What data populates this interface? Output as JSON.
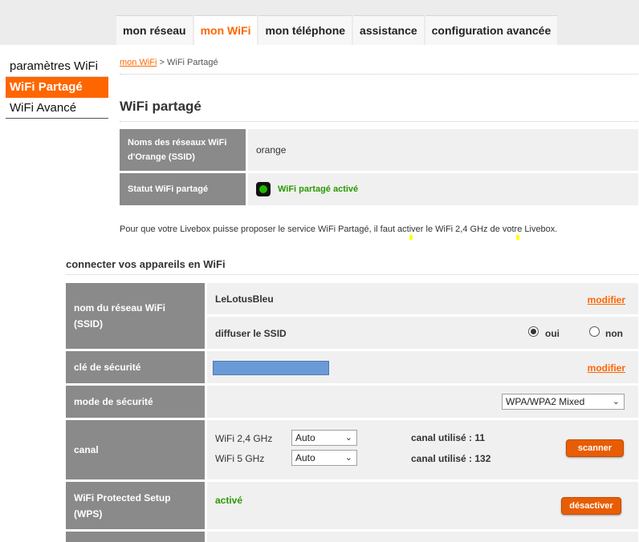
{
  "tabs": [
    {
      "label": "mon réseau"
    },
    {
      "label": "mon WiFi"
    },
    {
      "label": "mon téléphone"
    },
    {
      "label": "assistance"
    },
    {
      "label": "configuration avancée"
    }
  ],
  "active_tab": "mon WiFi",
  "sidebar": {
    "items": [
      {
        "label": "paramètres WiFi"
      },
      {
        "label": "WiFi Partagé"
      },
      {
        "label": "WiFi Avancé"
      }
    ],
    "active": "WiFi Partagé"
  },
  "breadcrumb": {
    "parent": "mon WiFi",
    "separator": " > ",
    "current": "WiFi Partagé"
  },
  "page_title": "WiFi partagé",
  "info": {
    "ssid_label": "Noms des réseaux WiFi d'Orange (SSID)",
    "ssid_value": "orange",
    "status_label": "Statut WiFi partagé",
    "status_value": "WiFi partagé activé"
  },
  "notice": "Pour que votre Livebox puisse proposer le service WiFi Partagé, il faut activer le WiFi 2,4 GHz de votre Livebox.",
  "section_title": "connecter vos appareils en WiFi",
  "config": {
    "ssid_label": "nom du réseau WiFi (SSID)",
    "ssid_value": "LeLotusBleu",
    "modify": "modifier",
    "broadcast_label": "diffuser le SSID",
    "yes": "oui",
    "no": "non",
    "broadcast_selected": "oui",
    "key_label": "clé de sécurité",
    "modify2": "modifier",
    "mode_label": "mode de sécurité",
    "mode_value": "WPA/WPA2 Mixed",
    "channel_label": "canal",
    "wifi24_label": "WiFi 2,4 GHz",
    "wifi24_value": "Auto",
    "wifi24_used": "canal utilisé : 11",
    "wifi5_label": "WiFi 5 GHz",
    "wifi5_value": "Auto",
    "wifi5_used": "canal utilisé : 132",
    "scan_button": "scanner",
    "wps_label": "WiFi Protected Setup (WPS)",
    "wps_status": "activé",
    "wps_button": "désactiver"
  },
  "colors": {
    "accent": "#ff6600",
    "label_bg": "#8a8a8a",
    "value_bg": "#f0f0f0",
    "active_green": "#2a9a00"
  },
  "icons": {
    "status": "status-led-icon",
    "dropdown": "chevron-down-icon"
  }
}
